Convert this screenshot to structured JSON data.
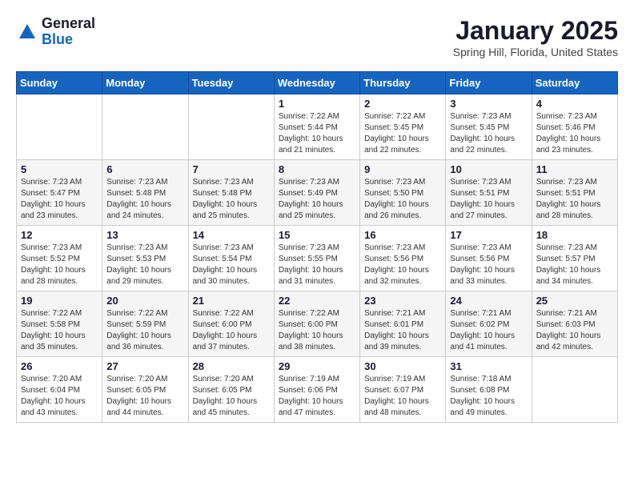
{
  "header": {
    "logo_general": "General",
    "logo_blue": "Blue",
    "month_title": "January 2025",
    "location": "Spring Hill, Florida, United States"
  },
  "days_of_week": [
    "Sunday",
    "Monday",
    "Tuesday",
    "Wednesday",
    "Thursday",
    "Friday",
    "Saturday"
  ],
  "weeks": [
    [
      {
        "day": "",
        "info": ""
      },
      {
        "day": "",
        "info": ""
      },
      {
        "day": "",
        "info": ""
      },
      {
        "day": "1",
        "info": "Sunrise: 7:22 AM\nSunset: 5:44 PM\nDaylight: 10 hours\nand 21 minutes."
      },
      {
        "day": "2",
        "info": "Sunrise: 7:22 AM\nSunset: 5:45 PM\nDaylight: 10 hours\nand 22 minutes."
      },
      {
        "day": "3",
        "info": "Sunrise: 7:23 AM\nSunset: 5:45 PM\nDaylight: 10 hours\nand 22 minutes."
      },
      {
        "day": "4",
        "info": "Sunrise: 7:23 AM\nSunset: 5:46 PM\nDaylight: 10 hours\nand 23 minutes."
      }
    ],
    [
      {
        "day": "5",
        "info": "Sunrise: 7:23 AM\nSunset: 5:47 PM\nDaylight: 10 hours\nand 23 minutes."
      },
      {
        "day": "6",
        "info": "Sunrise: 7:23 AM\nSunset: 5:48 PM\nDaylight: 10 hours\nand 24 minutes."
      },
      {
        "day": "7",
        "info": "Sunrise: 7:23 AM\nSunset: 5:48 PM\nDaylight: 10 hours\nand 25 minutes."
      },
      {
        "day": "8",
        "info": "Sunrise: 7:23 AM\nSunset: 5:49 PM\nDaylight: 10 hours\nand 25 minutes."
      },
      {
        "day": "9",
        "info": "Sunrise: 7:23 AM\nSunset: 5:50 PM\nDaylight: 10 hours\nand 26 minutes."
      },
      {
        "day": "10",
        "info": "Sunrise: 7:23 AM\nSunset: 5:51 PM\nDaylight: 10 hours\nand 27 minutes."
      },
      {
        "day": "11",
        "info": "Sunrise: 7:23 AM\nSunset: 5:51 PM\nDaylight: 10 hours\nand 28 minutes."
      }
    ],
    [
      {
        "day": "12",
        "info": "Sunrise: 7:23 AM\nSunset: 5:52 PM\nDaylight: 10 hours\nand 28 minutes."
      },
      {
        "day": "13",
        "info": "Sunrise: 7:23 AM\nSunset: 5:53 PM\nDaylight: 10 hours\nand 29 minutes."
      },
      {
        "day": "14",
        "info": "Sunrise: 7:23 AM\nSunset: 5:54 PM\nDaylight: 10 hours\nand 30 minutes."
      },
      {
        "day": "15",
        "info": "Sunrise: 7:23 AM\nSunset: 5:55 PM\nDaylight: 10 hours\nand 31 minutes."
      },
      {
        "day": "16",
        "info": "Sunrise: 7:23 AM\nSunset: 5:56 PM\nDaylight: 10 hours\nand 32 minutes."
      },
      {
        "day": "17",
        "info": "Sunrise: 7:23 AM\nSunset: 5:56 PM\nDaylight: 10 hours\nand 33 minutes."
      },
      {
        "day": "18",
        "info": "Sunrise: 7:23 AM\nSunset: 5:57 PM\nDaylight: 10 hours\nand 34 minutes."
      }
    ],
    [
      {
        "day": "19",
        "info": "Sunrise: 7:22 AM\nSunset: 5:58 PM\nDaylight: 10 hours\nand 35 minutes."
      },
      {
        "day": "20",
        "info": "Sunrise: 7:22 AM\nSunset: 5:59 PM\nDaylight: 10 hours\nand 36 minutes."
      },
      {
        "day": "21",
        "info": "Sunrise: 7:22 AM\nSunset: 6:00 PM\nDaylight: 10 hours\nand 37 minutes."
      },
      {
        "day": "22",
        "info": "Sunrise: 7:22 AM\nSunset: 6:00 PM\nDaylight: 10 hours\nand 38 minutes."
      },
      {
        "day": "23",
        "info": "Sunrise: 7:21 AM\nSunset: 6:01 PM\nDaylight: 10 hours\nand 39 minutes."
      },
      {
        "day": "24",
        "info": "Sunrise: 7:21 AM\nSunset: 6:02 PM\nDaylight: 10 hours\nand 41 minutes."
      },
      {
        "day": "25",
        "info": "Sunrise: 7:21 AM\nSunset: 6:03 PM\nDaylight: 10 hours\nand 42 minutes."
      }
    ],
    [
      {
        "day": "26",
        "info": "Sunrise: 7:20 AM\nSunset: 6:04 PM\nDaylight: 10 hours\nand 43 minutes."
      },
      {
        "day": "27",
        "info": "Sunrise: 7:20 AM\nSunset: 6:05 PM\nDaylight: 10 hours\nand 44 minutes."
      },
      {
        "day": "28",
        "info": "Sunrise: 7:20 AM\nSunset: 6:05 PM\nDaylight: 10 hours\nand 45 minutes."
      },
      {
        "day": "29",
        "info": "Sunrise: 7:19 AM\nSunset: 6:06 PM\nDaylight: 10 hours\nand 47 minutes."
      },
      {
        "day": "30",
        "info": "Sunrise: 7:19 AM\nSunset: 6:07 PM\nDaylight: 10 hours\nand 48 minutes."
      },
      {
        "day": "31",
        "info": "Sunrise: 7:18 AM\nSunset: 6:08 PM\nDaylight: 10 hours\nand 49 minutes."
      },
      {
        "day": "",
        "info": ""
      }
    ]
  ]
}
